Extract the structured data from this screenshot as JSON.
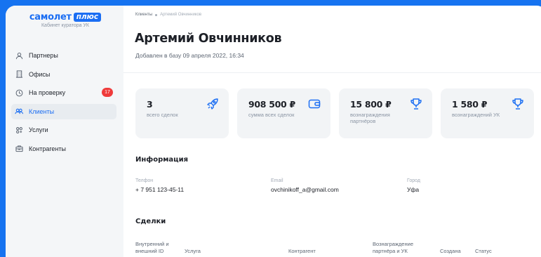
{
  "logo": {
    "word": "самолет",
    "badge": "плюс",
    "subtitle": "Кабинет куратора УК"
  },
  "sidebar": {
    "items": [
      {
        "label": "Партнеры",
        "icon": "user-icon",
        "active": false
      },
      {
        "label": "Офисы",
        "icon": "building-icon",
        "active": false
      },
      {
        "label": "На проверку",
        "icon": "clock-icon",
        "active": false,
        "badge": "17"
      },
      {
        "label": "Клиенты",
        "icon": "users-icon",
        "active": true
      },
      {
        "label": "Услуги",
        "icon": "services-icon",
        "active": false
      },
      {
        "label": "Контрагенты",
        "icon": "briefcase-icon",
        "active": false
      }
    ]
  },
  "breadcrumb": {
    "root": "Клиенты",
    "current": "Артемий Овчинников"
  },
  "client": {
    "name": "Артемий Овчинников",
    "added": "Добавлен в базу 09 апреля 2022, 16:34"
  },
  "stats": [
    {
      "value": "3",
      "label": "всего сделок",
      "icon": "rocket-icon"
    },
    {
      "value": "908 500 ₽",
      "label": "сумма всех сделок",
      "icon": "wallet-icon"
    },
    {
      "value": "15 800 ₽",
      "label": "вознаграждения партнёров",
      "icon": "trophy-icon"
    },
    {
      "value": "1 580 ₽",
      "label": "вознаграждений УК",
      "icon": "trophy-icon"
    }
  ],
  "info": {
    "title": "Информация",
    "phone": {
      "label": "Телфон",
      "value": "+ 7 951 123-45-11"
    },
    "email": {
      "label": "Email",
      "value": "ovchinikoff_a@gmail.com"
    },
    "city": {
      "label": "Город",
      "value": "Уфа"
    }
  },
  "deals": {
    "title": "Сделки",
    "columns": [
      "Внутренний и внешний ID",
      "Услуга",
      "Контрагент",
      "Вознаграждение партнёра и УК",
      "Создана",
      "Статус"
    ]
  },
  "colors": {
    "accent": "#1b6ef3",
    "background": "#1673f0",
    "badge": "#ef3b3b"
  }
}
